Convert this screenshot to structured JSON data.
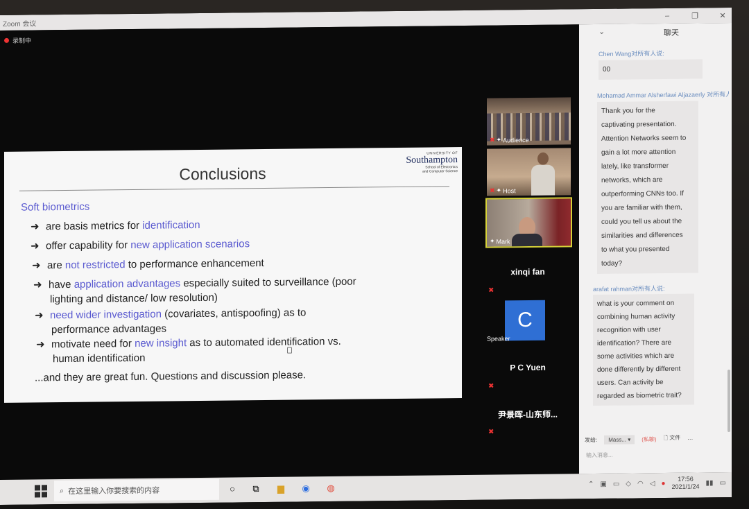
{
  "window": {
    "title": "Zoom 会议",
    "controls": [
      "‒",
      "❐",
      "✕"
    ]
  },
  "meeting": {
    "recording_label": "录制中"
  },
  "slide": {
    "title": "Conclusions",
    "logo": {
      "university_of": "UNIVERSITY OF",
      "name": "Southampton",
      "school_line1": "School of Electronics",
      "school_line2": "and Computer Science"
    },
    "heading": "Soft biometrics",
    "bullets": [
      {
        "pre": "are basis metrics for ",
        "hl": "identification",
        "post": ""
      },
      {
        "pre": "offer capability for ",
        "hl": "new application scenarios",
        "post": ""
      },
      {
        "pre": "are ",
        "hl": "not restricted",
        "post": " to performance enhancement"
      },
      {
        "pre": "have ",
        "hl": "application advantages",
        "post": " especially suited to surveillance (poor",
        "line2": "lighting and distance/ low resolution)"
      },
      {
        "pre": "",
        "hl": "need wider investigation",
        "post": " (covariates, antispoofing) as to",
        "line2": "performance advantages"
      },
      {
        "pre": "motivate need for ",
        "hl": "new insight",
        "post": " as to automated identification vs.",
        "line2": "human identification"
      }
    ],
    "closing": "...and they are great fun. Questions and discussion please."
  },
  "participants": {
    "tiles": [
      {
        "label": "Audience"
      },
      {
        "label": "Host"
      },
      {
        "label": "Mark"
      }
    ],
    "names": [
      "xinqi fan",
      "P C Yuen",
      "尹景晖-山东师..."
    ],
    "avatar_letter": "C",
    "speaker_label": "Speaker"
  },
  "chat": {
    "title": "聊天",
    "messages": [
      {
        "from": "Chen Wang对所有人说:",
        "lines": [
          "00"
        ]
      },
      {
        "from": "Mohamad Ammar Alsherfawi Aljazaerly 对所有人说:",
        "lines": [
          "Thank you for the",
          "captivating presentation.",
          "Attention Networks seem to",
          "gain a lot more attention",
          "lately, like transformer",
          "networks, which are",
          "outperforming CNNs too. If",
          "you are familiar with them,",
          "could you tell us about the",
          "similarities and differences",
          "to what you presented",
          "today?"
        ]
      },
      {
        "from": "arafat rahman对所有人说:",
        "lines": [
          "what is your comment on",
          "combining human activity",
          "recognition with user",
          "identification? There are",
          "some activities which are",
          "done differently by different",
          "users. Can activity be",
          "regarded as biometric trait?"
        ]
      }
    ],
    "send_label": "发给:",
    "send_target": "Mass...",
    "private_label": "(私聊)",
    "file_label": "文件",
    "input_placeholder": "输入消息..."
  },
  "taskbar": {
    "search_placeholder": "在这里输入你要搜索的内容",
    "time": "17:56",
    "date": "2021/1/24"
  }
}
